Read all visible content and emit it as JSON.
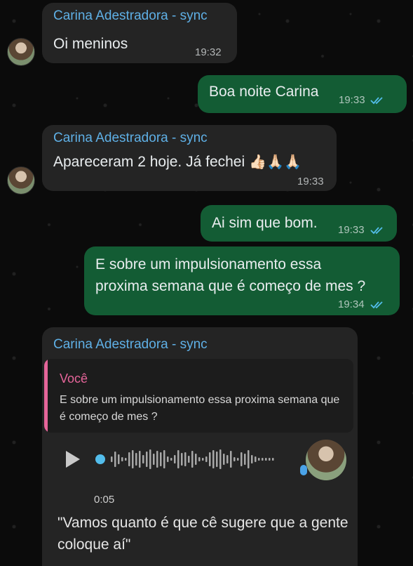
{
  "contact": {
    "name": "Carina Adestradora - sync"
  },
  "colors": {
    "incoming_bg": "#242424",
    "outgoing_bg": "#135c34",
    "sender_name": "#5fb0e6",
    "quote_accent": "#e6659a",
    "read_ticks": "#53bdeb"
  },
  "messages": [
    {
      "direction": "in",
      "sender": "Carina Adestradora - sync",
      "text": "Oi meninos",
      "time": "19:32"
    },
    {
      "direction": "out",
      "text": "Boa noite Carina",
      "time": "19:33",
      "status": "read"
    },
    {
      "direction": "in",
      "sender": "Carina Adestradora - sync",
      "text": "Apareceram 2 hoje. Já fechei",
      "emojis": "👍🏻🙏🏻🙏🏻",
      "time": "19:33"
    },
    {
      "direction": "out",
      "text": "Ai sim que bom.",
      "time": "19:33",
      "status": "read"
    },
    {
      "direction": "out",
      "text_lines": [
        "E sobre um impulsionamento essa",
        "proxima semana que é começo de mes ?"
      ],
      "time": "19:34",
      "status": "read"
    },
    {
      "direction": "in",
      "sender": "Carina Adestradora - sync",
      "quote": {
        "author": "Você",
        "text": "E sobre um impulsionamento essa proxima semana que é começo de mes ?"
      },
      "voice_note": {
        "duration": "0:05",
        "transcript": "\"Vamos quanto é que cê sugere que a gente coloque aí\""
      }
    }
  ]
}
